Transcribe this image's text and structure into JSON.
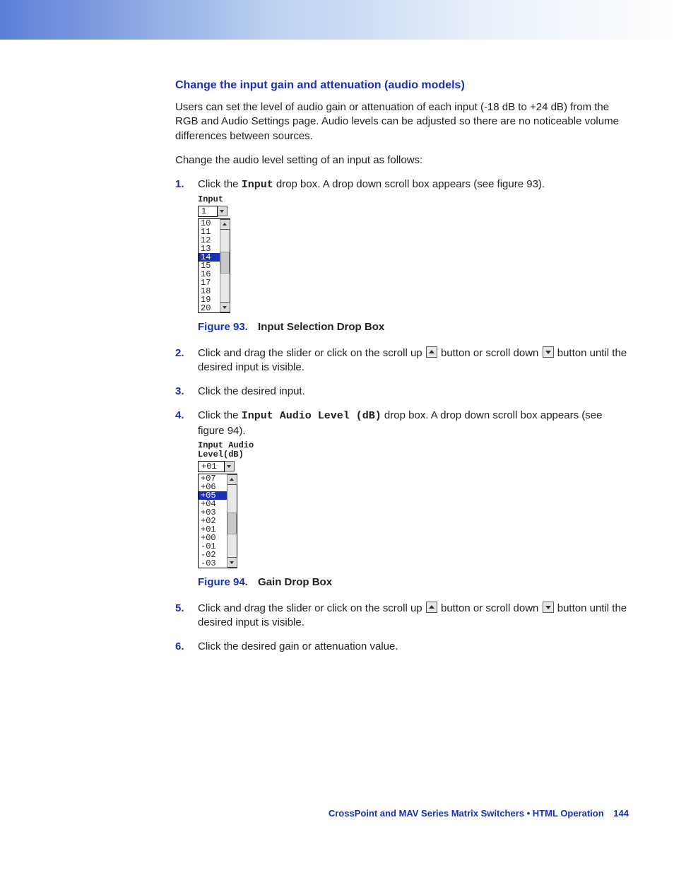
{
  "heading": "Change the input gain and attenuation (audio models)",
  "intro": "Users can set the level of audio gain or attenuation of each input (-18 dB to +24 dB) from the RGB and Audio Settings page. Audio levels can be adjusted so there are no noticeable volume differences between sources.",
  "lead": "Change the audio level setting of an input as follows:",
  "steps": {
    "s1": {
      "num": "1.",
      "pre": "Click the ",
      "mono": "Input",
      "post": " drop box. A drop down scroll box appears (see figure 93)."
    },
    "s2": {
      "num": "2.",
      "pre": "Click and drag the slider or click on the scroll up ",
      "mid": " button or scroll down ",
      "post": " button until the desired input is visible."
    },
    "s3": {
      "num": "3.",
      "text": "Click the desired input."
    },
    "s4": {
      "num": "4.",
      "pre": "Click the ",
      "mono": "Input Audio Level (dB)",
      "post": " drop box. A drop down scroll box appears (see figure 94)."
    },
    "s5": {
      "num": "5.",
      "pre": "Click and drag the slider or click on the scroll up ",
      "mid": " button or scroll down ",
      "post": " button until the desired input is visible."
    },
    "s6": {
      "num": "6.",
      "text": "Click the desired gain or attenuation value."
    }
  },
  "fig93": {
    "caption_label": "Figure 93.",
    "caption_title": "Input Selection Drop Box",
    "label": "Input",
    "current": "1",
    "options": [
      "10",
      "11",
      "12",
      "13",
      "14",
      "15",
      "16",
      "17",
      "18",
      "19",
      "20"
    ],
    "selected": "14"
  },
  "fig94": {
    "caption_label": "Figure 94.",
    "caption_title": "Gain Drop Box",
    "label_line1": "Input Audio",
    "label_line2": "Level(dB)",
    "current": "+01",
    "options": [
      "+07",
      "+06",
      "+05",
      "+04",
      "+03",
      "+02",
      "+01",
      "+00",
      "-01",
      "-02",
      "-03"
    ],
    "selected": "+05"
  },
  "footer": {
    "section": "CrossPoint and MAV Series Matrix Switchers • HTML Operation",
    "page": "144"
  }
}
